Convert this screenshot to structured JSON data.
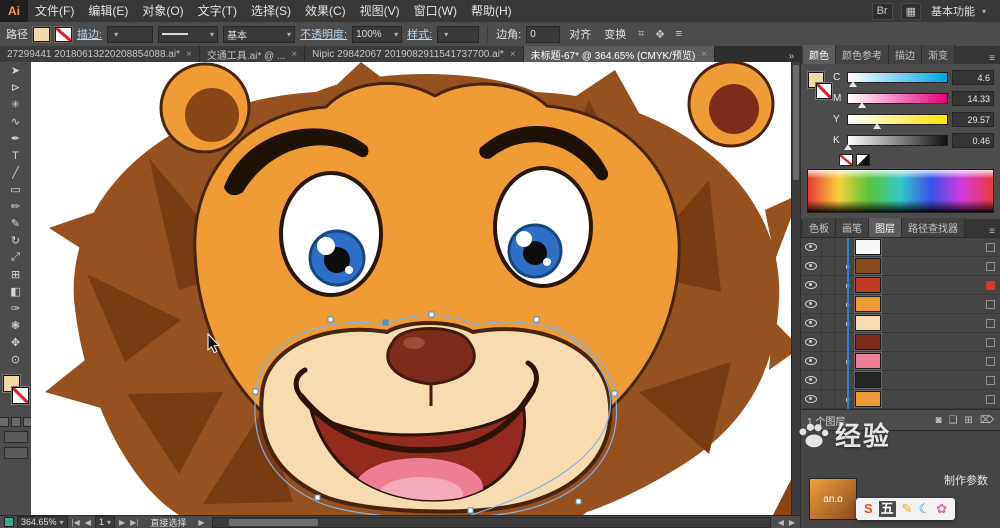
{
  "menubar": {
    "logo": "Ai",
    "items": [
      "文件(F)",
      "编辑(E)",
      "对象(O)",
      "文字(T)",
      "选择(S)",
      "效果(C)",
      "视图(V)",
      "窗口(W)",
      "帮助(H)"
    ],
    "right_icons": [
      "Br",
      "▦"
    ],
    "workspace": "基本功能"
  },
  "controlbar": {
    "context_label": "路径",
    "stroke_label": "描边:",
    "brush_value": "基本",
    "opacity_label": "不透明度:",
    "opacity_value": "100%",
    "style_label": "样式:",
    "corner_label": "边角:",
    "corner_value": "0",
    "align_label": "对齐",
    "transform_label": "变换"
  },
  "tabs": {
    "overflow": "»",
    "items": [
      {
        "label": "27299441 20180613220208854088.ai*",
        "active": false
      },
      {
        "label": "交通工具.ai* @ ...",
        "active": false
      },
      {
        "label": "Nipic 29842067 2019082911541737700.ai*",
        "active": false
      },
      {
        "label": "未标题-67* @ 364.65% (CMYK/预览)",
        "active": true
      }
    ]
  },
  "toolbar": {
    "fill_color": "#F2D9A8",
    "tools": [
      {
        "name": "selection-tool",
        "glyph": "➤"
      },
      {
        "name": "direct-selection-tool",
        "glyph": "⊳"
      },
      {
        "name": "magic-wand-tool",
        "glyph": "✳"
      },
      {
        "name": "lasso-tool",
        "glyph": "∿"
      },
      {
        "name": "pen-tool",
        "glyph": "✒"
      },
      {
        "name": "type-tool",
        "glyph": "T"
      },
      {
        "name": "line-segment-tool",
        "glyph": "╱"
      },
      {
        "name": "rectangle-tool",
        "glyph": "▭"
      },
      {
        "name": "paintbrush-tool",
        "glyph": "✏"
      },
      {
        "name": "pencil-tool",
        "glyph": "✎"
      },
      {
        "name": "rotate-tool",
        "glyph": "↻"
      },
      {
        "name": "scale-tool",
        "glyph": "⤢"
      },
      {
        "name": "mesh-tool",
        "glyph": "⊞"
      },
      {
        "name": "gradient-tool",
        "glyph": "◧"
      },
      {
        "name": "eyedropper-tool",
        "glyph": "✑"
      },
      {
        "name": "blend-tool",
        "glyph": "❃"
      },
      {
        "name": "hand-tool",
        "glyph": "✥"
      },
      {
        "name": "zoom-tool",
        "glyph": "⊙"
      }
    ]
  },
  "color_panel": {
    "tabs": [
      "颜色",
      "颜色参考",
      "描边",
      "渐变"
    ],
    "active_tab": "颜色",
    "sliders": [
      {
        "ch": "C",
        "value": "4.6",
        "pct": 4.6
      },
      {
        "ch": "M",
        "value": "14.33",
        "pct": 14.33
      },
      {
        "ch": "Y",
        "value": "29.57",
        "pct": 29.57
      },
      {
        "ch": "K",
        "value": "0.46",
        "pct": 0.46
      }
    ]
  },
  "panels": {
    "tabs": [
      "色板",
      "画笔",
      "图层",
      "路径查找器"
    ],
    "active": "图层",
    "footer": "1 个图层",
    "rows": [
      {
        "thumb": "#f8f8f8",
        "expand": false,
        "sel": ""
      },
      {
        "thumb": "#8a4a1c",
        "expand": true,
        "sel": ""
      },
      {
        "thumb": "#c23a22",
        "expand": true,
        "sel": "red"
      },
      {
        "thumb": "#f09c36",
        "expand": true,
        "sel": ""
      },
      {
        "thumb": "#f6dcae",
        "expand": true,
        "sel": ""
      },
      {
        "thumb": "#7e2b1b",
        "expand": false,
        "sel": ""
      },
      {
        "thumb": "#ee7e96",
        "expand": true,
        "sel": ""
      },
      {
        "thumb": "#262626",
        "expand": false,
        "sel": ""
      },
      {
        "thumb": "#f09c36",
        "expand": true,
        "sel": ""
      }
    ]
  },
  "statusbar": {
    "zoom": "364.65%",
    "artboard": "1",
    "tool_name": "直接选择"
  },
  "watermark": {
    "text": "经验"
  },
  "overlay": {
    "thumb_text": "an.o",
    "caption": "制作参数"
  },
  "ime": {
    "icons": [
      {
        "glyph": "S",
        "color": "#e84a2d",
        "bg": ""
      },
      {
        "glyph": "五",
        "color": "#ffffff",
        "bg": "#4a4a4a"
      },
      {
        "glyph": "✎",
        "color": "#e8a13a",
        "bg": ""
      },
      {
        "glyph": "☾",
        "color": "#3b7fd4",
        "bg": ""
      },
      {
        "glyph": "✿",
        "color": "#e06ba8",
        "bg": ""
      }
    ]
  }
}
